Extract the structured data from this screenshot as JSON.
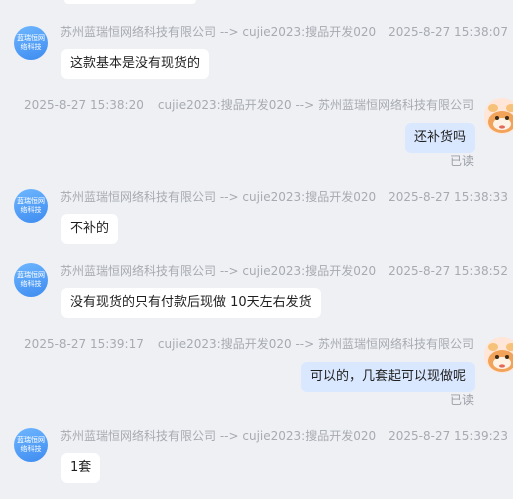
{
  "messages": [
    {
      "direction": "in",
      "sender": "苏州蓝瑞恒网络科技有限公司",
      "arrow": "-->",
      "receiver": "cujie2023:搜品开发020",
      "timestamp": "2025-8-27 15:38:07",
      "text": "这款基本是没有现货的",
      "avatar_text": "蓝瑞恒网络科技"
    },
    {
      "direction": "out",
      "sender": "cujie2023:搜品开发020",
      "arrow": "-->",
      "receiver": "苏州蓝瑞恒网络科技有限公司",
      "timestamp": "2025-8-27 15:38:20",
      "text": "还补货吗",
      "status": "已读"
    },
    {
      "direction": "in",
      "sender": "苏州蓝瑞恒网络科技有限公司",
      "arrow": "-->",
      "receiver": "cujie2023:搜品开发020",
      "timestamp": "2025-8-27 15:38:33",
      "text": "不补的",
      "avatar_text": "蓝瑞恒网络科技"
    },
    {
      "direction": "in",
      "sender": "苏州蓝瑞恒网络科技有限公司",
      "arrow": "-->",
      "receiver": "cujie2023:搜品开发020",
      "timestamp": "2025-8-27 15:38:52",
      "text": "没有现货的只有付款后现做 10天左右发货",
      "avatar_text": "蓝瑞恒网络科技"
    },
    {
      "direction": "out",
      "sender": "cujie2023:搜品开发020",
      "arrow": "-->",
      "receiver": "苏州蓝瑞恒网络科技有限公司",
      "timestamp": "2025-8-27 15:39:17",
      "text": "可以的，几套起可以现做呢",
      "status": "已读"
    },
    {
      "direction": "in",
      "sender": "苏州蓝瑞恒网络科技有限公司",
      "arrow": "-->",
      "receiver": "cujie2023:搜品开发020",
      "timestamp": "2025-8-27 15:39:23",
      "text": "1套",
      "avatar_text": "蓝瑞恒网络科技"
    }
  ]
}
